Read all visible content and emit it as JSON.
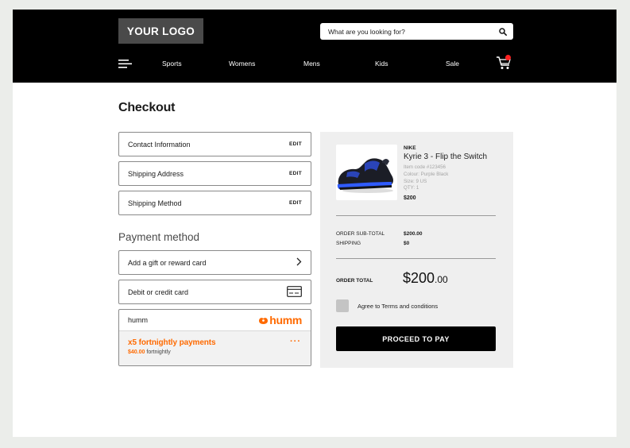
{
  "header": {
    "logo": "YOUR LOGO",
    "search_placeholder": "What are you looking for?",
    "nav": [
      "Sports",
      "Womens",
      "Mens",
      "Kids",
      "Sale"
    ]
  },
  "checkout": {
    "title": "Checkout",
    "steps": [
      {
        "label": "Contact Information",
        "action": "EDIT"
      },
      {
        "label": "Shipping Address",
        "action": "EDIT"
      },
      {
        "label": "Shipping Method",
        "action": "EDIT"
      }
    ],
    "payment_heading": "Payment method",
    "options": [
      {
        "label": "Add a gift or reward card",
        "icon": "chevron-right-icon"
      },
      {
        "label": "Debit or credit card",
        "icon": "credit-card-icon"
      }
    ],
    "humm": {
      "label": "humm",
      "logo_text": "humm",
      "headline": "x5 fortnightly payments",
      "amount": "$40.00",
      "period": "fortnightly",
      "more": "···"
    }
  },
  "summary": {
    "brand": "NIKE",
    "product": "Kyrie 3 - Flip the Switch",
    "item_code": "Item code #123456",
    "colour": "Colour: Purple Black",
    "size": "Size: 9 US",
    "qty": "QTY: 1",
    "price": "$200",
    "subtotal_label": "ORDER SUB-TOTAL",
    "subtotal_value": "$200.00",
    "shipping_label": "SHIPPING",
    "shipping_value": "$0",
    "total_label": "ORDER TOTAL",
    "total_main": "$200",
    "total_cents": ".00",
    "terms": "Agree to Terms and conditions",
    "cta": "PROCEED TO PAY"
  },
  "colors": {
    "header_bg": "#000000",
    "accent_orange": "#ff6a00",
    "cart_badge": "#ff2020",
    "summary_bg": "#efefef"
  }
}
